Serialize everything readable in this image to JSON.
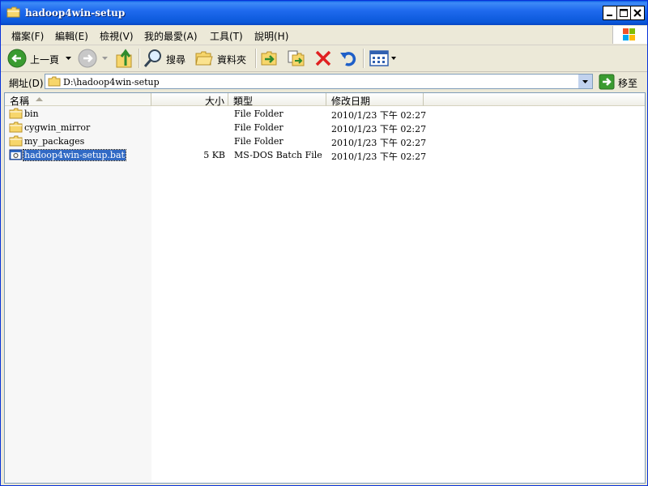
{
  "window": {
    "title": "hadoop4win-setup"
  },
  "menu": {
    "items": [
      "檔案(F)",
      "編輯(E)",
      "檢視(V)",
      "我的最愛(A)",
      "工具(T)",
      "說明(H)"
    ]
  },
  "toolbar": {
    "back_label": "上一頁",
    "search_label": "搜尋",
    "folders_label": "資料夾"
  },
  "address": {
    "label": "網址(D)",
    "value": "D:\\hadoop4win-setup",
    "go_label": "移至"
  },
  "list": {
    "columns": [
      "名稱",
      "大小",
      "類型",
      "修改日期"
    ],
    "rows": [
      {
        "name": "bin",
        "size": "",
        "type": "File Folder",
        "modified": "2010/1/23 下午 02:27",
        "icon": "folder-icon"
      },
      {
        "name": "cygwin_mirror",
        "size": "",
        "type": "File Folder",
        "modified": "2010/1/23 下午 02:27",
        "icon": "folder-icon"
      },
      {
        "name": "my_packages",
        "size": "",
        "type": "File Folder",
        "modified": "2010/1/23 下午 02:27",
        "icon": "folder-icon"
      },
      {
        "name": "hadoop4win-setup.bat",
        "size": "5 KB",
        "type": "MS-DOS Batch File",
        "modified": "2010/1/23 下午 02:27",
        "icon": "batch-file-icon",
        "selected": true
      }
    ]
  },
  "colors": {
    "titlebar": "#0A58DA",
    "selection": "#316AC5",
    "window_bg": "#ECE9D8"
  }
}
